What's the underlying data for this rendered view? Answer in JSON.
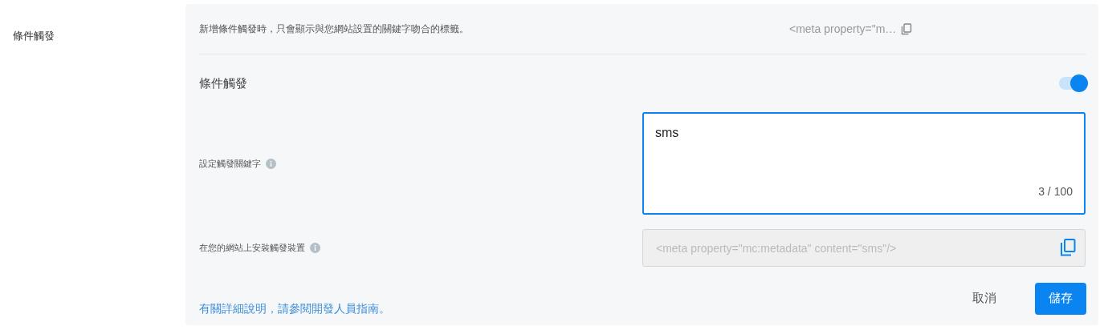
{
  "section_label": "條件觸發",
  "description": "新增條件觸發時，只會顯示與您網站設置的關鍵字吻合的標籤。",
  "meta_preview": "<meta property=\"m…",
  "toggle": {
    "label": "條件觸發",
    "on": true
  },
  "keyword": {
    "label": "設定觸發關鍵字",
    "value": "sms",
    "counter": "3 / 100"
  },
  "install": {
    "label": "在您的網站上安裝觸發裝置",
    "value": "<meta property=\"mc:metadata\" content=\"sms\"/>"
  },
  "guide_link": "有關詳細說明，請參閱開發人員指南。",
  "buttons": [
    {
      "label": "取消",
      "kind": "secondary"
    },
    {
      "label": "儲存",
      "kind": "primary"
    }
  ]
}
